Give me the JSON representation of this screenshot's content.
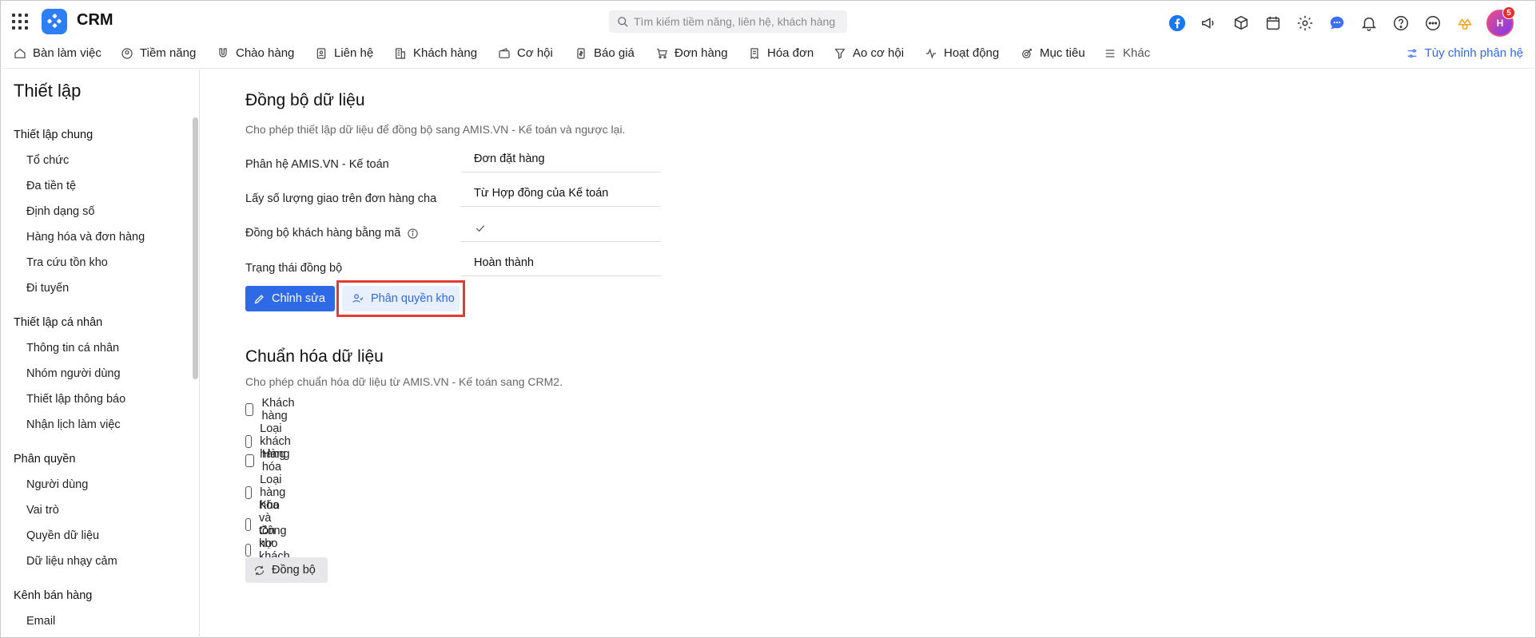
{
  "app": {
    "name": "CRM"
  },
  "search": {
    "placeholder": "Tìm kiếm tiềm năng, liên hệ, khách hàng"
  },
  "header": {
    "avatar_initials": "H",
    "notification_count": "5"
  },
  "nav": {
    "items": [
      {
        "label": "Bàn làm việc",
        "icon": "home-icon"
      },
      {
        "label": "Tiềm năng",
        "icon": "prospect-icon"
      },
      {
        "label": "Chào hàng",
        "icon": "magnet-icon"
      },
      {
        "label": "Liên hệ",
        "icon": "contact-icon"
      },
      {
        "label": "Khách hàng",
        "icon": "building-icon"
      },
      {
        "label": "Cơ hội",
        "icon": "wallet-icon"
      },
      {
        "label": "Báo giá",
        "icon": "quote-icon"
      },
      {
        "label": "Đơn hàng",
        "icon": "cart-icon"
      },
      {
        "label": "Hóa đơn",
        "icon": "invoice-icon"
      },
      {
        "label": "Ao cơ hội",
        "icon": "funnel-icon"
      },
      {
        "label": "Hoạt động",
        "icon": "activity-icon"
      },
      {
        "label": "Mục tiêu",
        "icon": "target-icon"
      },
      {
        "label": "Khác",
        "icon": "menu-icon"
      }
    ],
    "customize_label": "Tùy chỉnh phân hệ"
  },
  "sidebar": {
    "title": "Thiết lập",
    "groups": [
      {
        "label": "Thiết lập chung",
        "items": [
          "Tổ chức",
          "Đa tiền tệ",
          "Định dạng số",
          "Hàng hóa và đơn hàng",
          "Tra cứu tồn kho",
          "Đi tuyến"
        ]
      },
      {
        "label": "Thiết lập cá nhân",
        "items": [
          "Thông tin cá nhân",
          "Nhóm người dùng",
          "Thiết lập thông báo",
          "Nhận lịch làm việc"
        ]
      },
      {
        "label": "Phân quyền",
        "items": [
          "Người dùng",
          "Vai trò",
          "Quyền dữ liệu",
          "Dữ liệu nhạy cảm"
        ]
      },
      {
        "label": "Kênh bán hàng",
        "items": [
          "Email"
        ]
      }
    ]
  },
  "sync": {
    "title": "Đồng bộ dữ liệu",
    "description": "Cho phép thiết lập dữ liệu để đồng bộ sang AMIS.VN - Kế toán và ngược lại.",
    "fields": [
      {
        "label": "Phân hệ AMIS.VN - Kế toán",
        "value": "Đơn đặt hàng"
      },
      {
        "label": "Lấy số lượng giao trên đơn hàng cha",
        "value": "Từ Hợp đồng của Kế toán"
      },
      {
        "label": "Đồng bộ khách hàng bằng mã",
        "value": ""
      },
      {
        "label": "Trạng thái đồng bộ",
        "value": "Hoàn thành"
      }
    ],
    "edit_label": "Chỉnh sửa",
    "permission_label": "Phân quyền kho"
  },
  "normalize": {
    "title": "Chuẩn hóa dữ liệu",
    "description": "Cho phép chuẩn hóa dữ liệu từ AMIS.VN - Kế toán sang CRM2.",
    "options": [
      "Khách hàng",
      "Loại khách hàng",
      "Hàng hóa",
      "Loại hàng hóa",
      "Kho và tồn kho",
      "Công nợ khách hàng"
    ],
    "sync_button_label": "Đồng bộ"
  },
  "colors": {
    "accent": "#2f6ae6",
    "highlight_border": "#e53935"
  }
}
